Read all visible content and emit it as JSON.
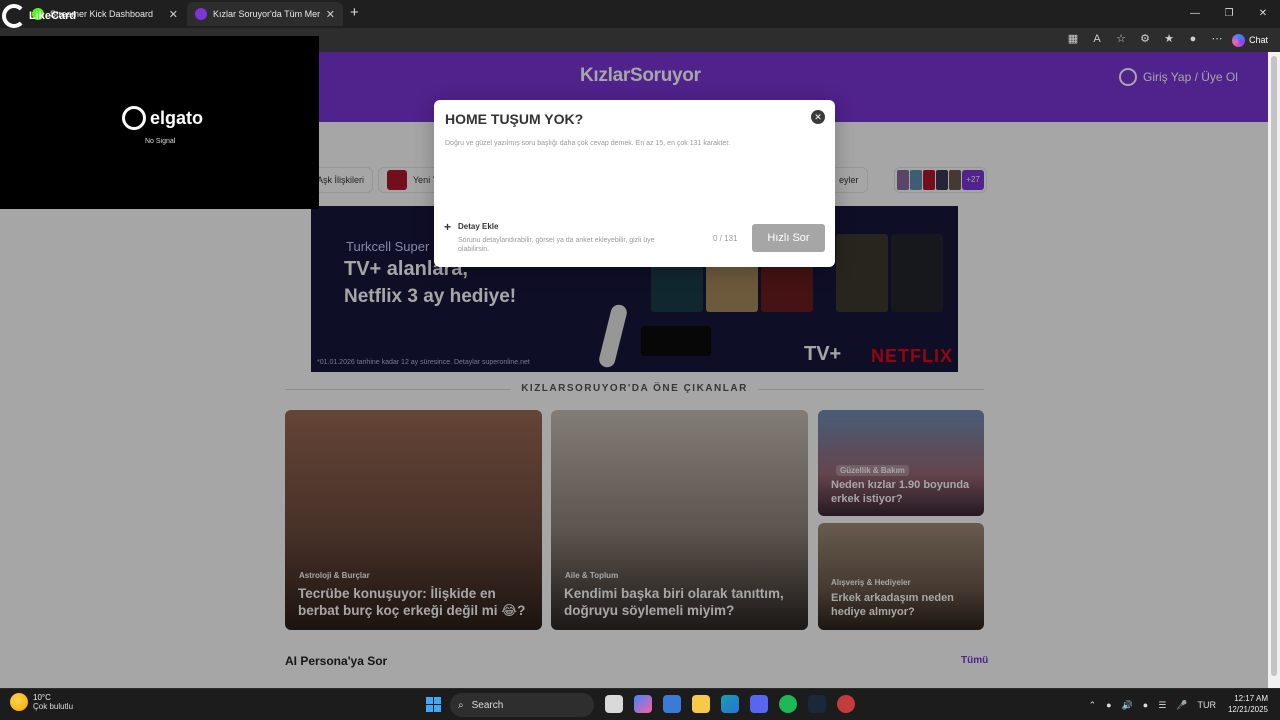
{
  "browser": {
    "tabs": [
      {
        "title": "Streamer Kick Dashboard",
        "favicon_color": "#53fc18"
      },
      {
        "title": "Kızlar Soruyor'da Tüm Merak Ettik",
        "favicon_color": "#7b35d8"
      }
    ],
    "new_tab": "+",
    "window_controls": [
      "—",
      "❐",
      "✕"
    ],
    "copilot_label": "Chat"
  },
  "overlay_widgets": {
    "likecard": "LikeCard",
    "elgato_brand": "elgato",
    "no_signal": "No Signal"
  },
  "site": {
    "logo": "KızlarSoruyor",
    "login": "Giriş Yap / Üye Ol",
    "accent": "#7b35d8"
  },
  "categories": {
    "chip1": "Aşk İlişkileri",
    "chip2": "Yeni Yı",
    "chip3": "eyler",
    "more_count": "+27"
  },
  "banner": {
    "line1": "Turkcell Super",
    "line2": "TV+ alanlara,",
    "line3": "Netflix 3 ay hediye!",
    "footnote": "*01.01.2026 tarihine kadar 12 ay süresince. Detaylar superonline.net",
    "tvplus": "TV+",
    "netflix": "NETFLIX"
  },
  "highlights": {
    "title": "KIZLARSORUYOR'DA ÖNE ÇIKANLAR",
    "cards": [
      {
        "category": "Astroloji & Burçlar",
        "title": "Tecrübe konuşuyor: İlişkide en berbat burç koç erkeği değil mi 😂?"
      },
      {
        "category": "Aile & Toplum",
        "title": "Kendimi başka biri olarak tanıttım, doğruyu söylemeli miyim?"
      },
      {
        "category": "Güzellik & Bakım",
        "title": "Neden kızlar 1.90 boyunda erkek istiyor?"
      },
      {
        "category": "Alışveriş & Hediyeler",
        "title": "Erkek arkadaşım neden hediye almıyor?"
      }
    ]
  },
  "ai_section": {
    "title": "AI Persona'ya Sor",
    "all_link": "Tümü"
  },
  "modal": {
    "question_value": "HOME TUŞUM YOK?",
    "hint": "Doğru ve güzel yazılmış soru başlığı daha çok cevap demek. En az 15, en çok 131 karakter.",
    "add_detail_label": "Detay Ekle",
    "add_detail_sub": "Sorunu detaylandırabilir, görsel ya da anket ekleyebilir, gizli üye olabilirsin.",
    "counter": "0 / 131",
    "submit_label": "Hızlı Sor"
  },
  "taskbar": {
    "temperature": "10°C",
    "weather": "Çok bulutlu",
    "search_label": "Search",
    "language": "TUR",
    "time": "12:17 AM",
    "date": "12/21/2025"
  }
}
